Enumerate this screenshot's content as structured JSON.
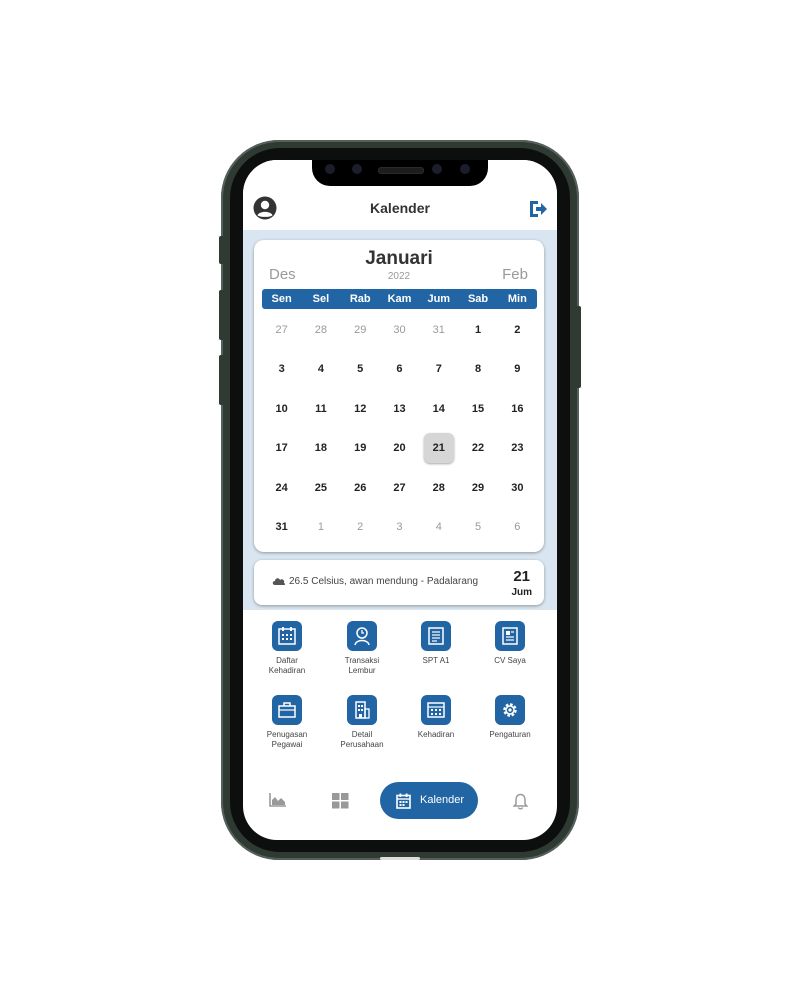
{
  "app": {
    "title": "Kalender"
  },
  "calendar": {
    "prev_month": "Des",
    "month": "Januari",
    "year": "2022",
    "next_month": "Feb",
    "weekdays": [
      "Sen",
      "Sel",
      "Rab",
      "Kam",
      "Jum",
      "Sab",
      "Min"
    ],
    "weeks": [
      [
        {
          "d": "27",
          "m": true
        },
        {
          "d": "28",
          "m": true
        },
        {
          "d": "29",
          "m": true
        },
        {
          "d": "30",
          "m": true
        },
        {
          "d": "31",
          "m": true
        },
        {
          "d": "1"
        },
        {
          "d": "2"
        }
      ],
      [
        {
          "d": "3"
        },
        {
          "d": "4"
        },
        {
          "d": "5"
        },
        {
          "d": "6"
        },
        {
          "d": "7"
        },
        {
          "d": "8"
        },
        {
          "d": "9"
        }
      ],
      [
        {
          "d": "10"
        },
        {
          "d": "11"
        },
        {
          "d": "12"
        },
        {
          "d": "13"
        },
        {
          "d": "14"
        },
        {
          "d": "15"
        },
        {
          "d": "16"
        }
      ],
      [
        {
          "d": "17"
        },
        {
          "d": "18"
        },
        {
          "d": "19"
        },
        {
          "d": "20"
        },
        {
          "d": "21",
          "s": true
        },
        {
          "d": "22"
        },
        {
          "d": "23"
        }
      ],
      [
        {
          "d": "24"
        },
        {
          "d": "25"
        },
        {
          "d": "26"
        },
        {
          "d": "27"
        },
        {
          "d": "28"
        },
        {
          "d": "29"
        },
        {
          "d": "30"
        }
      ],
      [
        {
          "d": "31"
        },
        {
          "d": "1",
          "m": true
        },
        {
          "d": "2",
          "m": true
        },
        {
          "d": "3",
          "m": true
        },
        {
          "d": "4",
          "m": true
        },
        {
          "d": "5",
          "m": true
        },
        {
          "d": "6",
          "m": true
        }
      ]
    ]
  },
  "weather": {
    "text": "26.5 Celsius, awan mendung - Padalarang",
    "day": "21",
    "weekday": "Jum"
  },
  "menu": {
    "items": [
      {
        "label_1": "Daftar",
        "label_2": "Kehadiran",
        "icon": "calendar-list-icon"
      },
      {
        "label_1": "Transaksi",
        "label_2": "Lembur",
        "icon": "person-clock-icon"
      },
      {
        "label_1": "SPT A1",
        "label_2": "",
        "icon": "tax-document-icon"
      },
      {
        "label_1": "CV Saya",
        "label_2": "",
        "icon": "cv-document-icon"
      },
      {
        "label_1": "Penugasan",
        "label_2": "Pegawai",
        "icon": "briefcase-icon"
      },
      {
        "label_1": "Detail",
        "label_2": "Perusahaan",
        "icon": "building-icon"
      },
      {
        "label_1": "Kehadiran",
        "label_2": "",
        "icon": "attendance-calendar-icon"
      },
      {
        "label_1": "Pengaturan",
        "label_2": "",
        "icon": "gear-icon"
      }
    ]
  },
  "bottom_nav": {
    "active_label": "Kalender",
    "items": [
      "area-chart-icon",
      "grid-icon",
      "calendar-icon",
      "bell-icon"
    ]
  },
  "colors": {
    "primary": "#2265a4",
    "background_band": "#d9e6f1",
    "muted": "#9a9a9a"
  }
}
